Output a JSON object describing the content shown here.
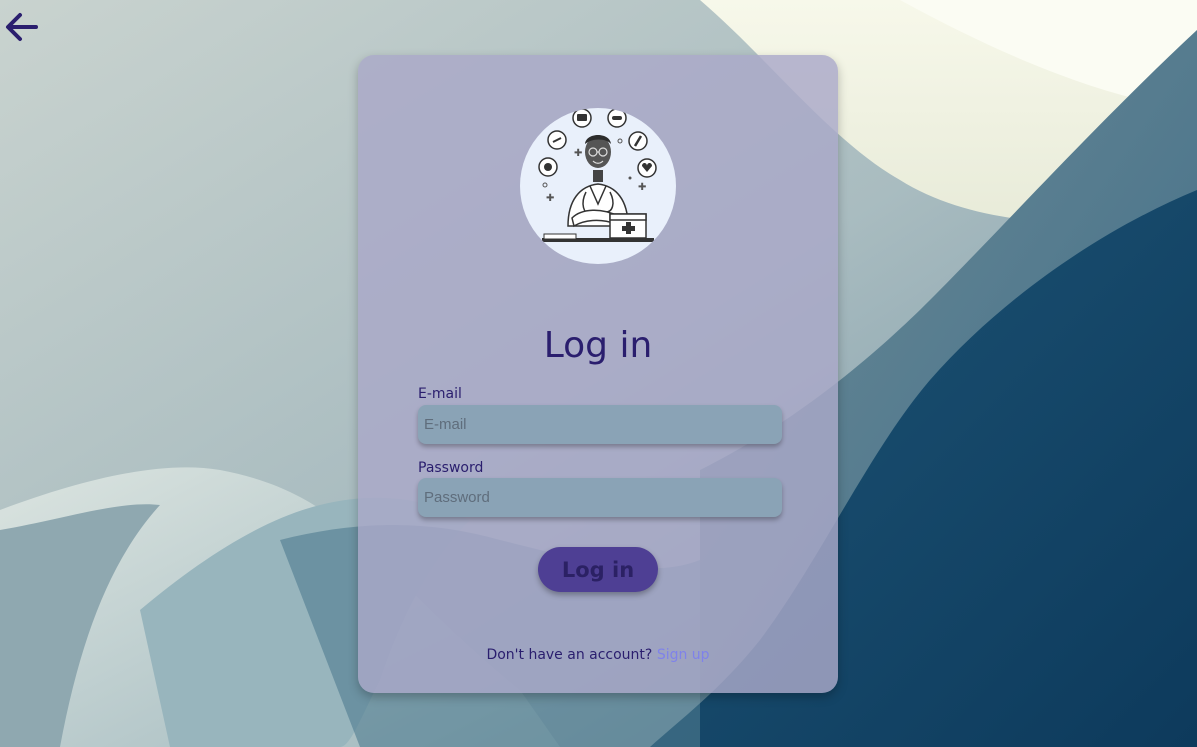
{
  "nav": {
    "back_icon": "arrow-left-icon"
  },
  "login": {
    "title": "Log in",
    "email_label": "E-mail",
    "email_placeholder": "E-mail",
    "email_value": "",
    "password_label": "Password",
    "password_placeholder": "Password",
    "password_value": "",
    "submit_label": "Log in",
    "signup_prompt": "Don't have an account?",
    "signup_link": "Sign up",
    "illustration": "doctor-illustration"
  },
  "colors": {
    "card": "#aaa8c8",
    "title": "#2a1e6e",
    "input_bg": "#8aa3b6",
    "button_bg": "#4e3f94",
    "link": "#7f82ea"
  }
}
